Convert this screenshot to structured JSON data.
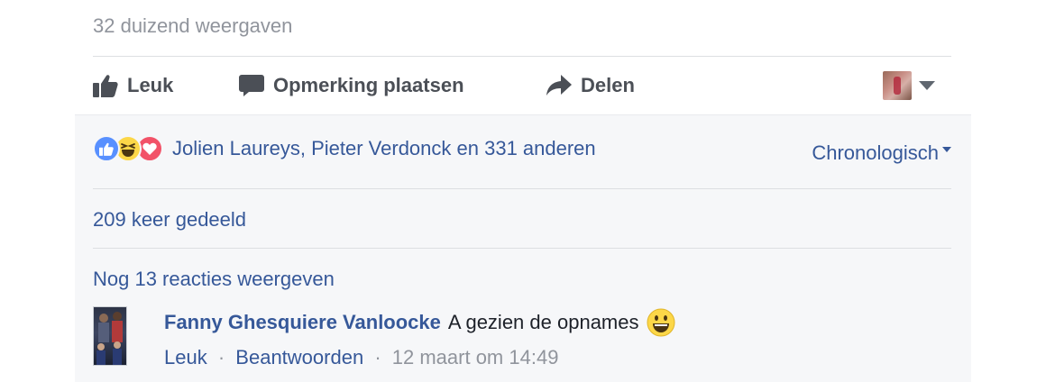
{
  "post": {
    "views": "32 duizend weergaven"
  },
  "actions": {
    "like_label": "Leuk",
    "comment_label": "Opmerking plaatsen",
    "share_label": "Delen"
  },
  "reactions": {
    "icons": [
      "like-icon",
      "haha-icon",
      "love-icon"
    ],
    "summary": "Jolien Laureys, Pieter Verdonck en 331 anderen",
    "sort_label": "Chronologisch"
  },
  "shares": "209 keer gedeeld",
  "comments": {
    "more_label": "Nog 13 reacties weergeven",
    "items": [
      {
        "author": "Fanny Ghesquiere Vanloocke",
        "text": "A gezien de opnames",
        "like_label": "Leuk",
        "reply_label": "Beantwoorden",
        "separator": "·",
        "timestamp": "12 maart om 14:49"
      }
    ]
  },
  "colors": {
    "link": "#365899",
    "muted": "#90949c",
    "panel_bg": "#f6f7f9",
    "like_blue": "#5890ff",
    "love_red": "#f25268",
    "haha_yellow": "#fcd748"
  }
}
